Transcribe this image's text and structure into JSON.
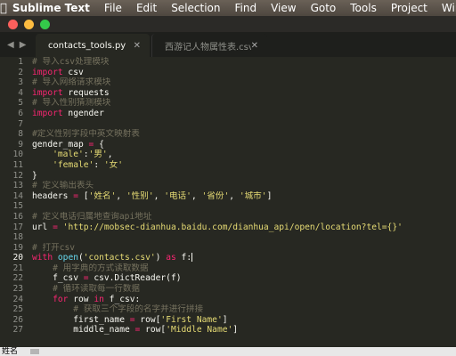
{
  "menubar": {
    "app": "Sublime Text",
    "items": [
      "File",
      "Edit",
      "Selection",
      "Find",
      "View",
      "Goto",
      "Tools",
      "Project",
      "Window"
    ]
  },
  "tabs": [
    {
      "label": "contacts_tools.py",
      "active": true
    },
    {
      "label": "西游记人物属性表.csv",
      "active": false
    }
  ],
  "editor": {
    "current_line": 20,
    "lines": [
      {
        "n": "1",
        "html": "<span class='c'># 导入csv处理模块</span>"
      },
      {
        "n": "2",
        "html": "<span class='k'>import</span> csv"
      },
      {
        "n": "3",
        "html": "<span class='c'># 导入网络请求模块</span>"
      },
      {
        "n": "4",
        "html": "<span class='k'>import</span> requests"
      },
      {
        "n": "5",
        "html": "<span class='c'># 导入性别猜测模块</span>"
      },
      {
        "n": "6",
        "html": "<span class='k'>import</span> ngender"
      },
      {
        "n": "7",
        "html": ""
      },
      {
        "n": "8",
        "html": "<span class='c'>#定义性别字段中英文映射表</span>"
      },
      {
        "n": "9",
        "html": "gender_map <span class='k'>=</span> {"
      },
      {
        "n": "10",
        "html": "    <span class='s'>'male'</span>:<span class='s'>'男'</span>,"
      },
      {
        "n": "11",
        "html": "    <span class='s'>'female'</span>: <span class='s'>'女'</span>"
      },
      {
        "n": "12",
        "html": "}"
      },
      {
        "n": "13",
        "html": "<span class='c'># 定义输出表头</span>"
      },
      {
        "n": "14",
        "html": "headers <span class='k'>=</span> [<span class='s'>'姓名'</span>, <span class='s'>'性别'</span>, <span class='s'>'电话'</span>, <span class='s'>'省份'</span>, <span class='s'>'城市'</span>]"
      },
      {
        "n": "15",
        "html": ""
      },
      {
        "n": "16",
        "html": "<span class='c'># 定义电话归属地查询api地址</span>"
      },
      {
        "n": "17",
        "html": "url <span class='k'>=</span> <span class='s'>'http://mobsec-dianhua.baidu.com/dianhua_api/open/location?tel={}'</span>"
      },
      {
        "n": "18",
        "html": ""
      },
      {
        "n": "19",
        "html": "<span class='c'># 打开csv</span>"
      },
      {
        "n": "20",
        "html": "<span class='k'>with</span> <span class='f'>open</span>(<span class='s'>'contacts.csv'</span>) <span class='k'>as</span> f:<span class='cursor'></span>"
      },
      {
        "n": "21",
        "html": "    <span class='c'># 用字典的方式读取数据</span>"
      },
      {
        "n": "22",
        "html": "    f_csv <span class='k'>=</span> csv.DictReader(f)"
      },
      {
        "n": "23",
        "html": "    <span class='c'># 循环读取每一行数据</span>"
      },
      {
        "n": "24",
        "html": "    <span class='k'>for</span> row <span class='k'>in</span> f_csv:"
      },
      {
        "n": "25",
        "html": "        <span class='c'># 获取三个字段的名字并进行拼接</span>"
      },
      {
        "n": "26",
        "html": "        first_name <span class='k'>=</span> row[<span class='s'>'First Name'</span>]"
      },
      {
        "n": "27",
        "html": "        middle_name <span class='k'>=</span> row[<span class='s'>'Middle Name'</span>]"
      }
    ]
  },
  "bottom": {
    "label": "姓名"
  },
  "colors": {
    "background": "#272822",
    "keyword": "#f92672",
    "string": "#e6db74",
    "comment": "#75715e",
    "function": "#66d9ef"
  }
}
